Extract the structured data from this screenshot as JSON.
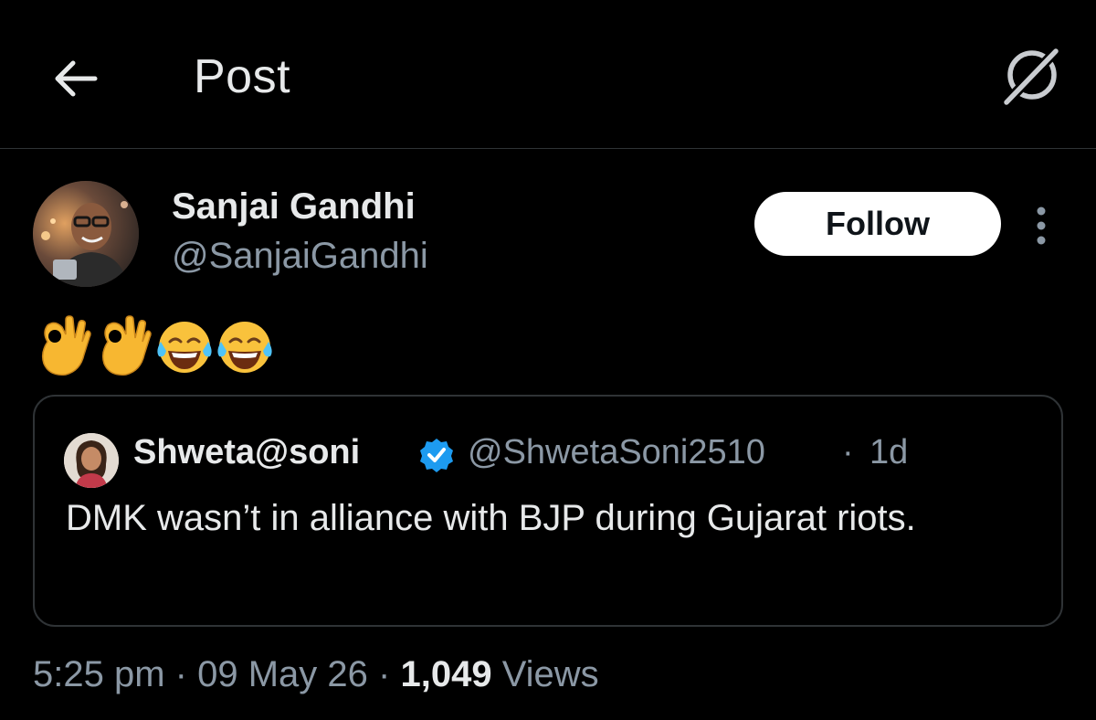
{
  "header": {
    "title": "Post",
    "back_icon": "arrow-left-icon",
    "grok_icon": "grok-icon"
  },
  "author": {
    "name": "Sanjai Gandhi",
    "handle": "@SanjaiGandhi",
    "follow_label": "Follow",
    "more_icon": "more-vertical-icon"
  },
  "post": {
    "emojis": [
      "ok-hand-emoji",
      "ok-hand-emoji",
      "tears-of-joy-emoji",
      "tears-of-joy-emoji"
    ]
  },
  "quote": {
    "name": "Shweta@soni",
    "verified": true,
    "handle": "@ShwetaSoni2510",
    "separator": "·",
    "time": "1d",
    "text": "DMK wasn’t in alliance with BJP during Gujarat riots."
  },
  "meta": {
    "time": "5:25 pm",
    "date": "09 May 26",
    "views_count": "1,049",
    "views_label": "Views",
    "separator": "·"
  },
  "colors": {
    "background": "#000000",
    "primary_text": "#e7e9ea",
    "secondary_text": "#8b98a5",
    "border": "#2f3336",
    "verified_blue": "#1d9bf0",
    "follow_bg": "#ffffff"
  }
}
